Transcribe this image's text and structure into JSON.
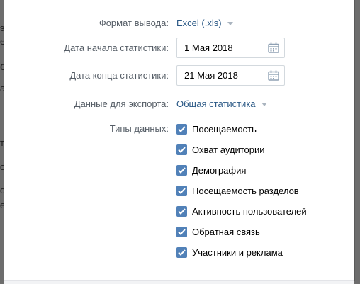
{
  "form": {
    "format_label": "Формат вывода:",
    "format_value": "Excel (.xls)",
    "start_label": "Дата начала статистики:",
    "start_value": "1 Мая 2018",
    "end_label": "Дата конца статистики:",
    "end_value": "21 Мая 2018",
    "export_label": "Данные для экспорта:",
    "export_value": "Общая статистика",
    "types_label": "Типы данных:",
    "types": [
      {
        "label": "Посещаемость",
        "checked": true
      },
      {
        "label": "Охват аудитории",
        "checked": true
      },
      {
        "label": "Демография",
        "checked": true
      },
      {
        "label": "Посещаемость разделов",
        "checked": true
      },
      {
        "label": "Активность пользователей",
        "checked": true
      },
      {
        "label": "Обратная связь",
        "checked": true
      },
      {
        "label": "Участники и реклама",
        "checked": true
      }
    ]
  },
  "icons": {
    "dropdown": "chevron-down-icon",
    "calendar": "calendar-icon",
    "checkbox": "checkmark-icon"
  },
  "colors": {
    "accent": "#5181b8",
    "link": "#2a5885",
    "label": "#555d66",
    "border": "#d3d9de"
  }
}
